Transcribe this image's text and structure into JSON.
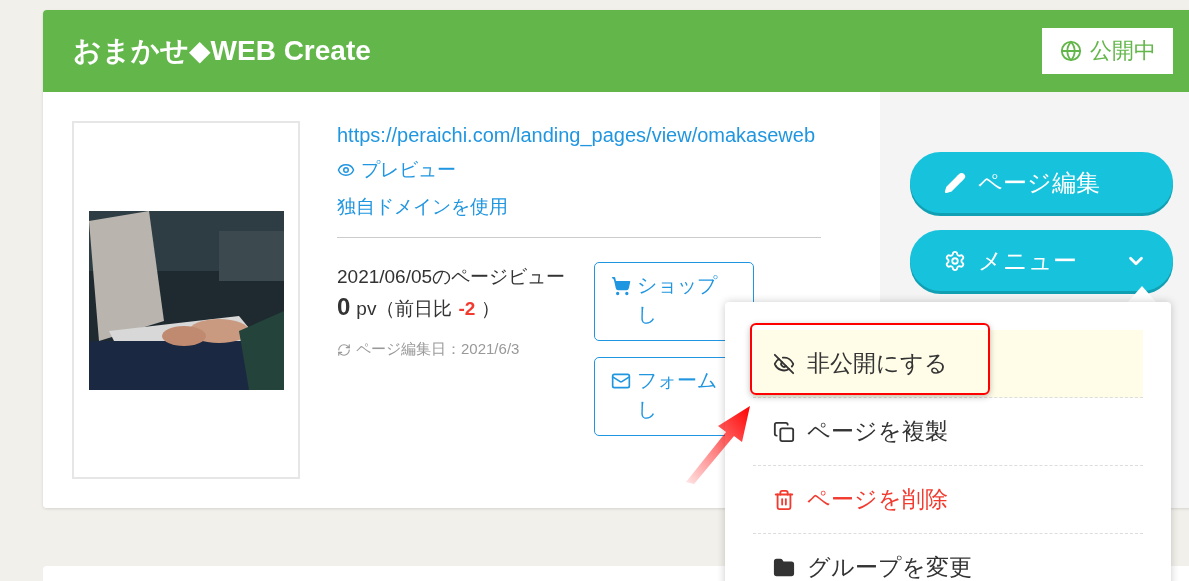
{
  "header": {
    "title": "おまかせ◆WEB Create",
    "status": {
      "label": "公開中",
      "published": true
    }
  },
  "page": {
    "url": "https://peraichi.com/landing_pages/view/omakaseweb",
    "links": [
      {
        "label": "プレビュー",
        "kind": "preview"
      },
      {
        "label": "独自ドメインを使用",
        "kind": "plain"
      }
    ],
    "stats": {
      "title": "2021/06/05のページビュー",
      "pv": "0",
      "unit": "pv（前日比",
      "diff": "-2",
      "close": "）",
      "edited": "ページ編集日：2021/6/3"
    },
    "option_buttons": [
      {
        "lines": [
          "ショップ",
          "し"
        ],
        "kind": "shop"
      },
      {
        "lines": [
          "フォーム",
          "し"
        ],
        "kind": "form"
      }
    ]
  },
  "actions": [
    {
      "label": "ページ編集",
      "kind": "edit"
    },
    {
      "label": "メニュー",
      "kind": "menu",
      "expanded": true
    }
  ],
  "menu": [
    {
      "label": "非公開にする",
      "kind": "unpublish",
      "selected": true
    },
    {
      "label": "ページを複製",
      "kind": "duplicate",
      "selected": false
    },
    {
      "label": "ページを削除",
      "kind": "delete",
      "selected": false
    },
    {
      "label": "グループを変更",
      "kind": "group",
      "selected": false
    }
  ]
}
